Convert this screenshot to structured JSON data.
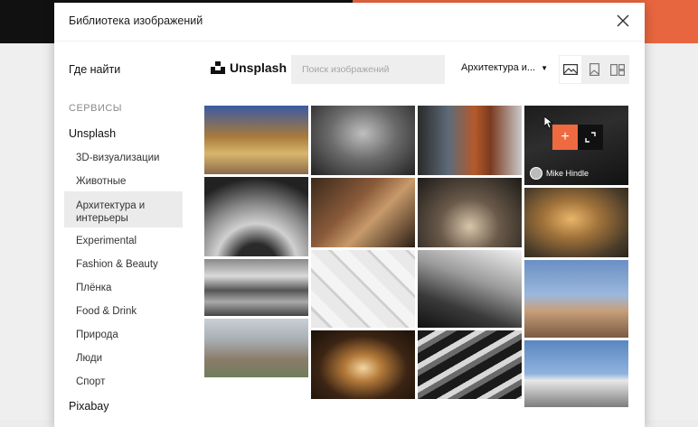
{
  "modal": {
    "title": "Библиотека изображений"
  },
  "header": {
    "where_label": "Где найти",
    "provider_name": "Unsplash",
    "search_placeholder": "Поиск изображений",
    "category_selected": "Архитектура и...",
    "view_modes": [
      "landscape-view-icon",
      "portrait-view-icon",
      "split-view-icon"
    ]
  },
  "sidebar": {
    "section_title": "СЕРВИСЫ",
    "provider_unsplash": "Unsplash",
    "categories": [
      "3D-визуализации",
      "Животные",
      "Архитектура и интерьеры",
      "Experimental",
      "Fashion & Beauty",
      "Плёнка",
      "Food & Drink",
      "Природа",
      "Люди",
      "Спорт"
    ],
    "provider_pixabay": "Pixabay"
  },
  "grid": {
    "hover_author": "Mike Hindle",
    "add_symbol": "+"
  },
  "colors": {
    "accent": "#ef6a40",
    "top_left_bg": "#111111",
    "top_right_bg": "#e8663f"
  }
}
